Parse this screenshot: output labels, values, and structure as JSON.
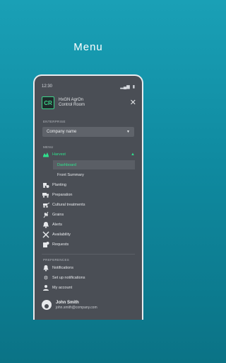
{
  "headline": "Menu",
  "colors": {
    "accent": "#2fe08c",
    "drawer_bg": "#4a4e55",
    "page_bg": "#1197ad"
  },
  "statusbar": {
    "time": "12:30"
  },
  "logo": {
    "badge": "CR",
    "line1": "HxGN AgrOn",
    "line2": "Control Room"
  },
  "enterprise": {
    "section_label": "ENTERPRISE",
    "selected_company": "Company name"
  },
  "menu": {
    "section_label": "MENU",
    "harvest": {
      "label": "Harvest",
      "icon": "harvest-icon"
    },
    "harvest_sub": [
      "Dashboard",
      "Front Summary"
    ],
    "items": [
      {
        "label": "Planting",
        "icon": "tractor-icon"
      },
      {
        "label": "Preparation",
        "icon": "truck-icon"
      },
      {
        "label": "Cultural treatments",
        "icon": "sprayer-icon"
      },
      {
        "label": "Grains",
        "icon": "grain-icon"
      },
      {
        "label": "Alerts",
        "icon": "alert-icon"
      },
      {
        "label": "Availability",
        "icon": "tools-icon"
      },
      {
        "label": "Requests",
        "icon": "requests-icon"
      }
    ]
  },
  "preferences": {
    "section_label": "PREFERENCES",
    "items": [
      {
        "label": "Notifications",
        "icon": "bell-icon"
      },
      {
        "label": "Set up notifications",
        "icon": "gear-icon"
      },
      {
        "label": "My account",
        "icon": "account-icon"
      }
    ]
  },
  "user": {
    "name": "John Smith",
    "email": "john.smith@company.com"
  }
}
